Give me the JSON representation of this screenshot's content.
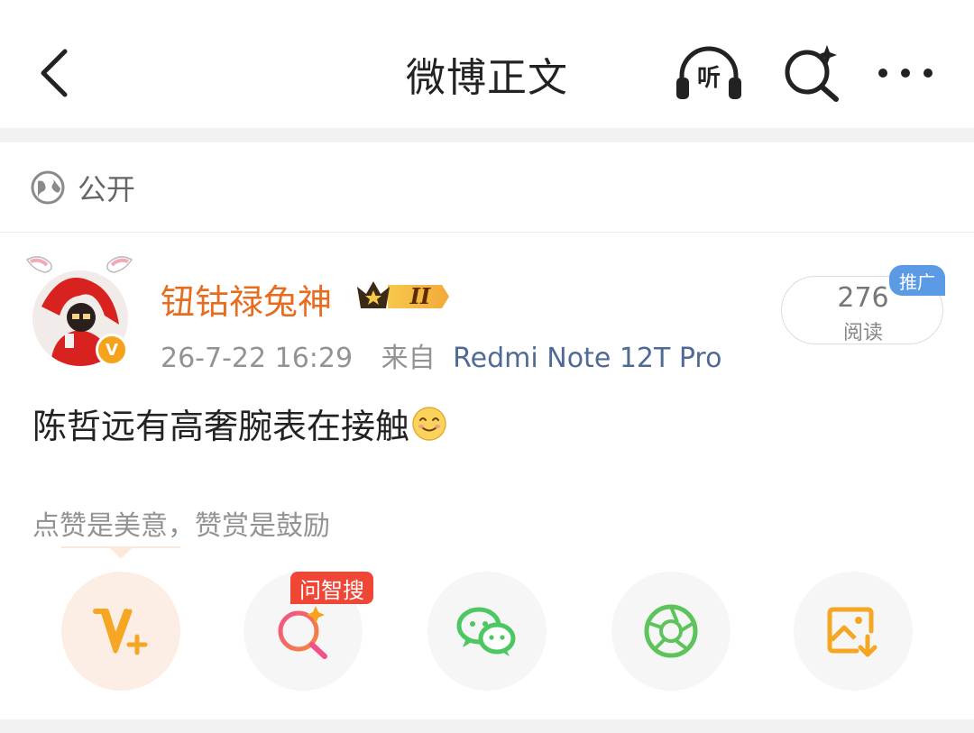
{
  "header": {
    "title": "微博正文",
    "listen_label": "听"
  },
  "visibility": {
    "label": "公开"
  },
  "post": {
    "author": "钮钴禄兔神",
    "member_badge": "II",
    "verified_mark": "V",
    "timestamp": "26-7-22 16:29",
    "source_prefix": "来自",
    "device": "Redmi Note 12T Pro",
    "text": "陈哲远有高奢腕表在接触",
    "read_count": "276",
    "read_label": "阅读",
    "promo_tag": "推广"
  },
  "reward": {
    "tip": "点赞是美意，赞赏是鼓励"
  },
  "actions": {
    "wzs_tag": "问智搜"
  },
  "colors": {
    "username": "#e86c1f",
    "device_link": "#506a96",
    "promo_blue": "#5b9be6",
    "reward_orange": "#f5a623",
    "wzs_red": "#f04636",
    "wechat_green": "#4cc762",
    "moments_green": "#5cc45a",
    "save_orange": "#f5a623"
  }
}
